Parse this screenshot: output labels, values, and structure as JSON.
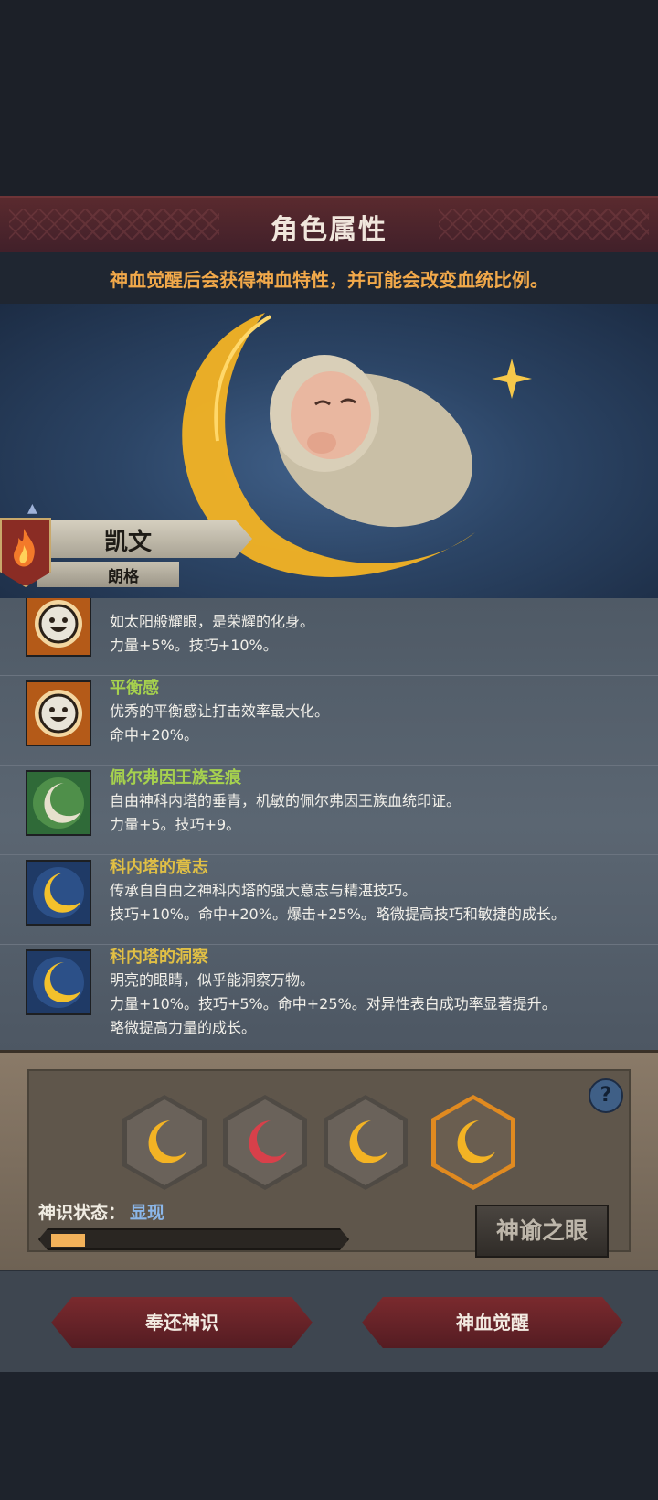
{
  "header": {
    "title": "角色属性",
    "subtitle": "神血觉醒后会获得神血特性，并可能会改变血统比例。"
  },
  "character": {
    "name": "凯文",
    "surname": "朗格"
  },
  "traits": [
    {
      "name": "",
      "desc": "如太阳般耀眼，是荣耀的化身。",
      "stat": "力量+5%。技巧+10%。",
      "icon": "sun-face-icon"
    },
    {
      "name": "平衡感",
      "desc": "优秀的平衡感让打击效率最大化。",
      "stat": "命中+20%。",
      "icon": "sun-face-icon"
    },
    {
      "name": "佩尔弗因王族圣痕",
      "desc": "自由神科内塔的垂青，机敏的佩尔弗因王族血统印证。",
      "stat": "力量+5。技巧+9。",
      "icon": "white-crescent-icon"
    },
    {
      "name": "科内塔的意志",
      "desc": "传承自自由之神科内塔的强大意志与精湛技巧。",
      "stat": "技巧+10%。命中+20%。爆击+25%。略微提高技巧和敏捷的成长。",
      "icon": "gold-crescent-icon"
    },
    {
      "name": "科内塔的洞察",
      "desc": "明亮的眼睛，似乎能洞察万物。",
      "stat": "力量+10%。技巧+5%。命中+25%。对异性表白成功率显著提升。",
      "stat2": "略微提高力量的成长。",
      "icon": "gold-crescent-icon"
    }
  ],
  "divine": {
    "state_label": "神识状态：",
    "state_value": "显现",
    "progress": 0.12,
    "oracle_button": "神谕之眼",
    "help": "?"
  },
  "buttons": {
    "return": "奉还神识",
    "awaken": "神血觉醒"
  },
  "colors": {
    "trait_green": "#a6d14e",
    "trait_gold": "#e0bf45",
    "subtitle_orange": "#f2a94a",
    "state_blue": "#8bb6e8",
    "active_hex": "#e08a20"
  }
}
